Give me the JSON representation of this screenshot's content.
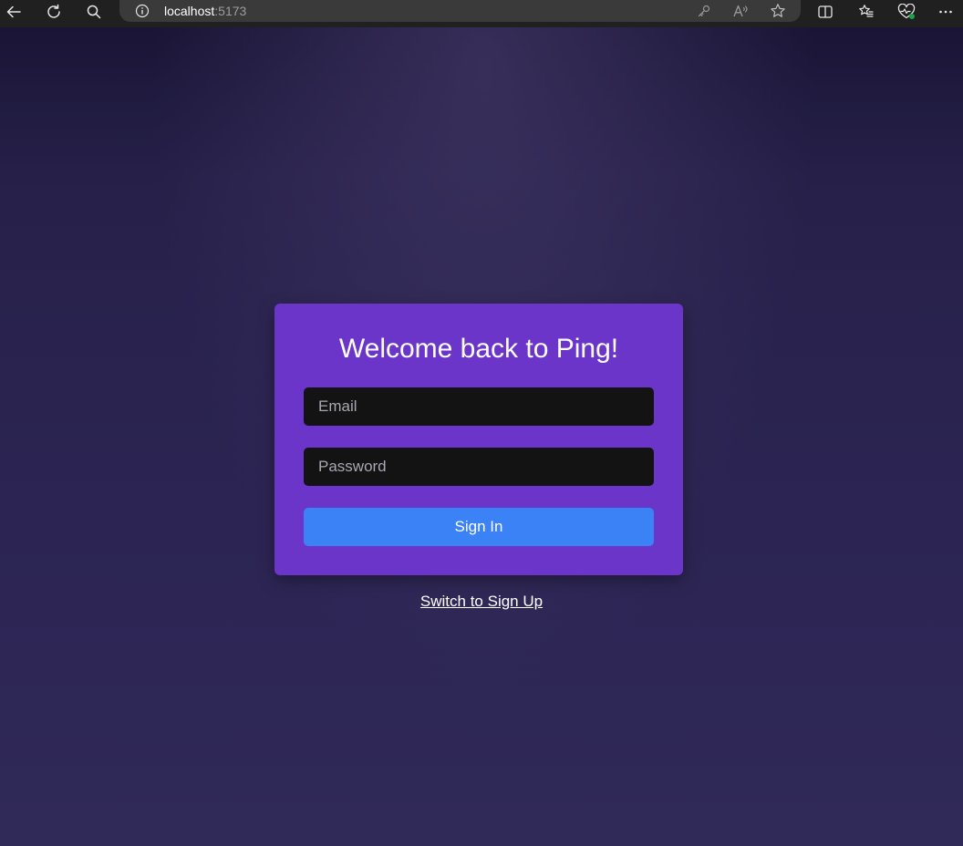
{
  "browser": {
    "url_host": "localhost",
    "url_port": ":5173",
    "icons": {
      "back": "back-arrow-icon",
      "refresh": "refresh-icon",
      "search": "search-icon",
      "site_info": "info-icon",
      "password": "key-icon",
      "read_aloud": "read-aloud-icon",
      "favorite": "star-icon",
      "split_screen": "split-screen-icon",
      "favorites": "favorites-list-icon",
      "browser_essentials": "heart-pulse-icon",
      "menu": "more-icon"
    }
  },
  "login": {
    "title": "Welcome back to Ping!",
    "email_placeholder": "Email",
    "email_value": "",
    "password_placeholder": "Password",
    "password_value": "",
    "submit_label": "Sign In",
    "switch_label": "Switch to Sign Up"
  },
  "colors": {
    "background": "#2b2450",
    "card": "#6a35c8",
    "input": "#131313",
    "button": "#3b82f6",
    "text": "#ffffff"
  }
}
